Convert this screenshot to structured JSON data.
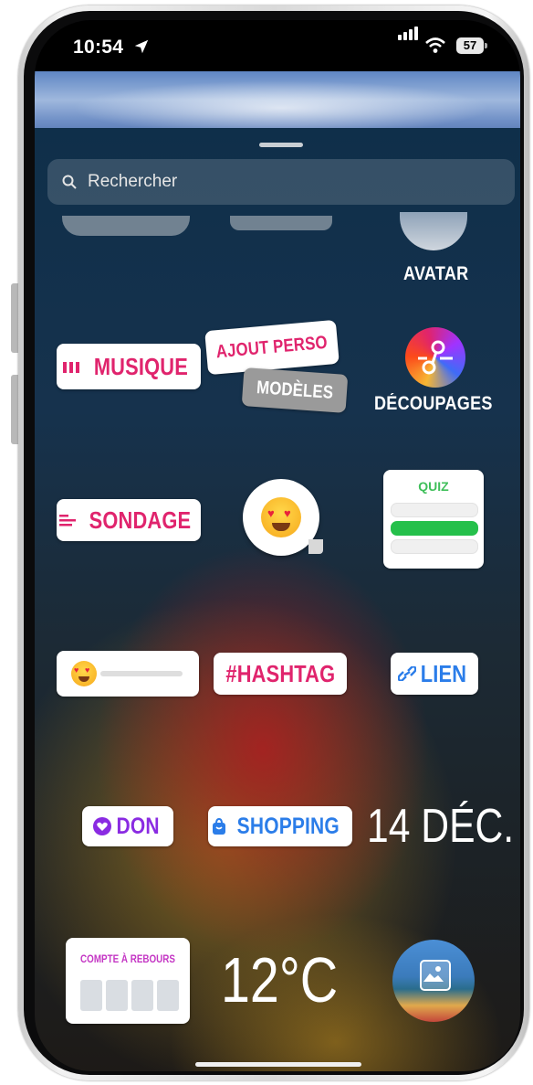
{
  "status_bar": {
    "time": "10:54",
    "battery": "57"
  },
  "search": {
    "placeholder": "Rechercher"
  },
  "stickers": {
    "avatar": "AVATAR",
    "music": "MUSIQUE",
    "add_yours": "AJOUT PERSO",
    "templates": "MODÈLES",
    "cutouts": "DÉCOUPAGES",
    "poll": "SONDAGE",
    "quiz": "QUIZ",
    "hashtag": "#HASHTAG",
    "link": "LIEN",
    "donation": "DON",
    "shopping": "SHOPPING",
    "date": "14 DÉC.",
    "countdown": "COMPTE À REBOURS",
    "temperature": "12°C"
  },
  "colors": {
    "pink": "#e0246d",
    "blue": "#2b7de9",
    "purple": "#8a2be2",
    "green": "#25c04b"
  },
  "icons": [
    "location-arrow-icon",
    "signal-icon",
    "wifi-icon",
    "battery-icon",
    "search-icon",
    "music-bars-icon",
    "scissors-icon",
    "poll-lines-icon",
    "link-icon",
    "heart-icon",
    "shopping-bag-icon",
    "heart-eyes-emoji-icon",
    "image-gallery-icon"
  ]
}
